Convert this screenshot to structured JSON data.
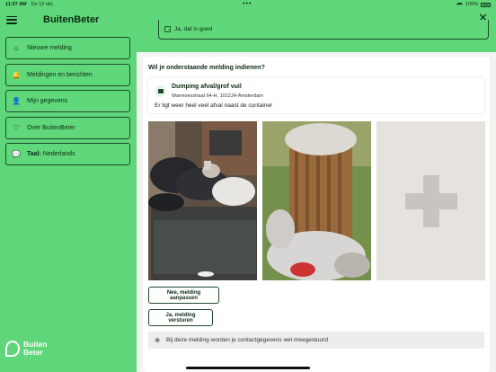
{
  "statusbar": {
    "time": "11:07 AM",
    "date": "Do 12 okt.",
    "battery": "100%"
  },
  "sidebar": {
    "title": "BuitenBeter",
    "items": [
      {
        "label": "Nieuwe melding",
        "icon": "home-icon",
        "glyph": "⌂"
      },
      {
        "label": "Meldingen en berichten",
        "icon": "bell-icon",
        "glyph": "🔔"
      },
      {
        "label": "Mijn gegevens",
        "icon": "user-icon",
        "glyph": "👤"
      },
      {
        "label": "Over BuitenBeter",
        "icon": "heart-icon",
        "glyph": "♡"
      },
      {
        "label_bold": "Taal:",
        "label": " Nederlands",
        "icon": "language-icon",
        "glyph": "💬"
      }
    ],
    "logo": {
      "line1": "Buiten",
      "line2": "Beter"
    }
  },
  "main": {
    "confirm": "Ja, dat is goed",
    "question": "Wil je onderstaande melding indienen?",
    "report": {
      "title": "Dumping afval/grof vuil",
      "address": "Warmoesstraat 64-H, 1012JH Amsterdam",
      "description": "Er ligt weer heel veel afval naast de container"
    },
    "buttons": {
      "edit": "Nee, melding aanpassen",
      "send": "Ja, melding versturen"
    },
    "notice": "Bij deze melding worden je contactgegevens wel meegestuurd"
  },
  "colors": {
    "brand_green": "#5fd67a",
    "dark_text": "#0c2a14",
    "panel_bg": "#ffffff"
  }
}
